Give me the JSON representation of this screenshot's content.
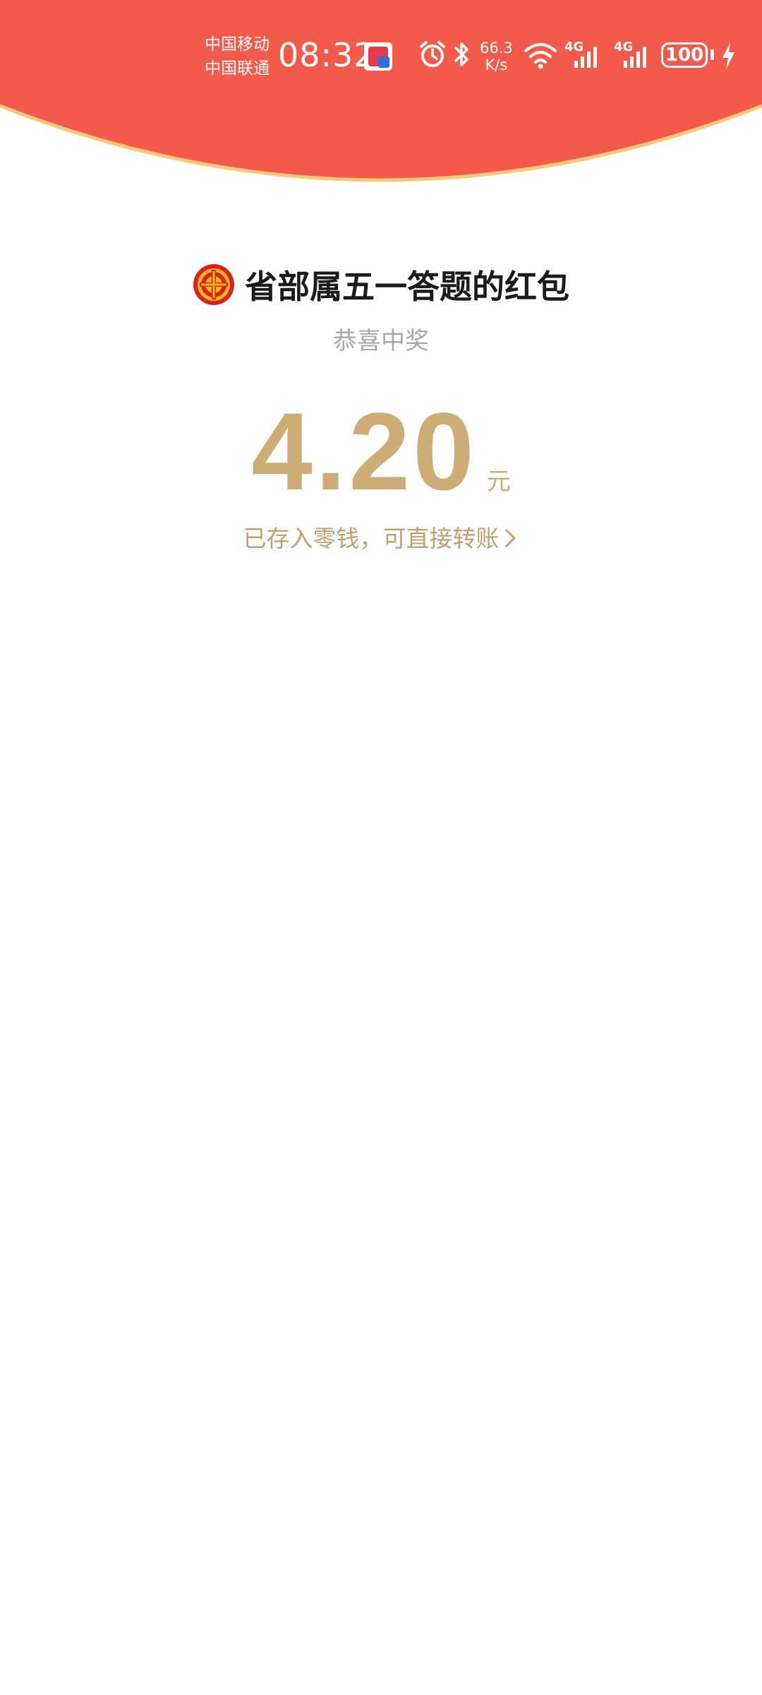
{
  "status_bar": {
    "carrier_1": "中国移动",
    "carrier_2": "中国联通",
    "time": "08:32",
    "net_speed_value": "66.3",
    "net_speed_unit": "K/s",
    "signal_1_label": "4G",
    "signal_2_label": "4G",
    "battery": "100",
    "icons": [
      "app-notification-icon",
      "alarm-icon",
      "bluetooth-icon",
      "wifi-icon",
      "signal-icon",
      "signal-icon",
      "battery-icon",
      "charging-icon"
    ]
  },
  "nav": {
    "back_icon": "chevron-left-icon",
    "more_icon": "more-dots-icon"
  },
  "packet": {
    "sender_logo": "union-emblem-icon",
    "title": "省部属五一答题的红包",
    "subtitle": "恭喜中奖",
    "amount": "4.20",
    "unit": "元",
    "deposit_text": "已存入零钱，可直接转账"
  },
  "colors": {
    "header_red": "#f45a4b",
    "header_border": "#f7c97a",
    "amount_gold": "#cdac76",
    "link_gold": "#c0a070",
    "subtitle_gray": "#a8a8a8",
    "title_black": "#1b1b1b"
  }
}
